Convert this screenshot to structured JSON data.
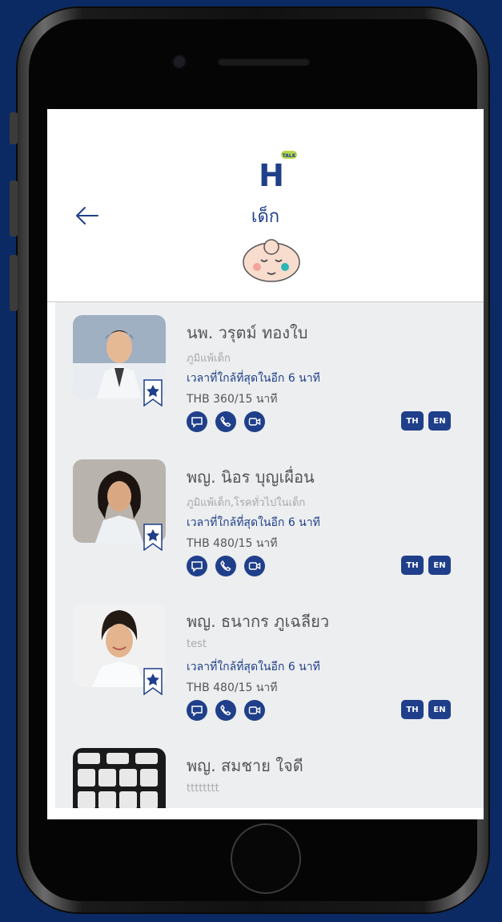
{
  "app": {
    "logo_badge": "TALK",
    "logo_letter": "H",
    "title": "เด็ก",
    "back_icon": "back-arrow-icon",
    "category_icon": "baby-face-icon"
  },
  "colors": {
    "primary": "#1f3f8a",
    "background": "#0b2a63",
    "list_bg": "#eceeef"
  },
  "doctors": [
    {
      "name": "นพ. วรุตม์ ทองใบ",
      "specialty": "ภูมิแพ้เด็ก",
      "availability": "เวลาที่ใกล้ที่สุดในอีก 6 นาที",
      "price": "THB 360/15 นาที",
      "lang_th": "TH",
      "lang_en": "EN"
    },
    {
      "name": "พญ. นิอร บุญเผื่อน",
      "specialty": "ภูมิแพ้เด็ก,โรคทั่วไปในเด็ก",
      "availability": "เวลาที่ใกล้ที่สุดในอีก 6 นาที",
      "price": "THB 480/15 นาที",
      "lang_th": "TH",
      "lang_en": "EN"
    },
    {
      "name": "พญ. ธนากร ภูเฉลียว",
      "specialty": "test",
      "availability": "เวลาที่ใกล้ที่สุดในอีก 6 นาที",
      "price": "THB 480/15 นาที",
      "lang_th": "TH",
      "lang_en": "EN"
    },
    {
      "name": "พญ. สมชาย ใจดี",
      "specialty": "tttttttt"
    }
  ]
}
